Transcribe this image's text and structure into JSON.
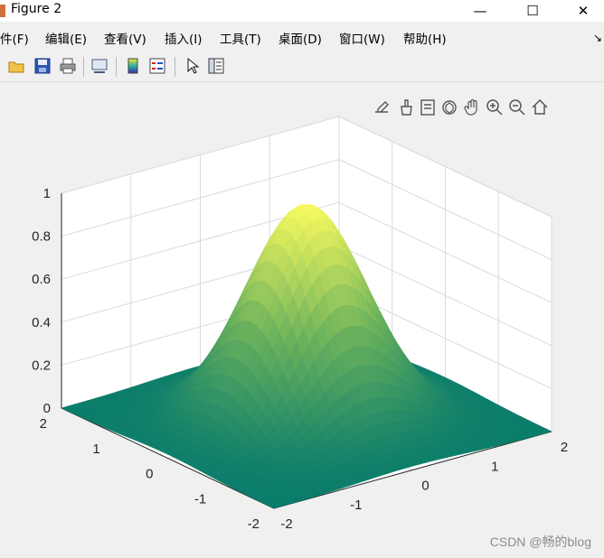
{
  "window": {
    "title": "Figure 2",
    "minimize_glyph": "—",
    "maximize_glyph": "☐",
    "close_glyph": "✕"
  },
  "menu": [
    "件(F)",
    "编辑(E)",
    "查看(V)",
    "插入(I)",
    "工具(T)",
    "桌面(D)",
    "窗口(W)",
    "帮助(H)"
  ],
  "toolbar": {
    "icons": [
      "open-file-icon",
      "save-icon",
      "print-icon",
      "link-plot-icon",
      "insert-colorbar-icon",
      "insert-legend-icon",
      "edit-plot-icon",
      "property-inspector-icon"
    ]
  },
  "axes_toolbar": {
    "icons": [
      "export-icon",
      "brush-icon",
      "datatip-icon",
      "rotate-3d-icon",
      "pan-icon",
      "zoom-in-icon",
      "zoom-out-icon",
      "restore-view-icon"
    ]
  },
  "chart_data": {
    "type": "surface",
    "function": "z = exp(-(x^2 + y^2))",
    "x_range": [
      -2,
      2
    ],
    "y_range": [
      -2,
      2
    ],
    "zlim": [
      0,
      1
    ],
    "z_ticks": [
      "0",
      "0.2",
      "0.4",
      "0.6",
      "0.8",
      "1"
    ],
    "x_ticks": [
      "-2",
      "-1",
      "0",
      "1",
      "2"
    ],
    "y_ticks": [
      "-2",
      "-1",
      "0",
      "1",
      "2"
    ],
    "colormap": "parula-like green-yellow",
    "colors": {
      "low": "#0b7d6b",
      "mid": "#6db35c",
      "high": "#f6f95e"
    },
    "grid": true,
    "view": "default 3-D"
  },
  "watermark": "CSDN @畅的blog"
}
